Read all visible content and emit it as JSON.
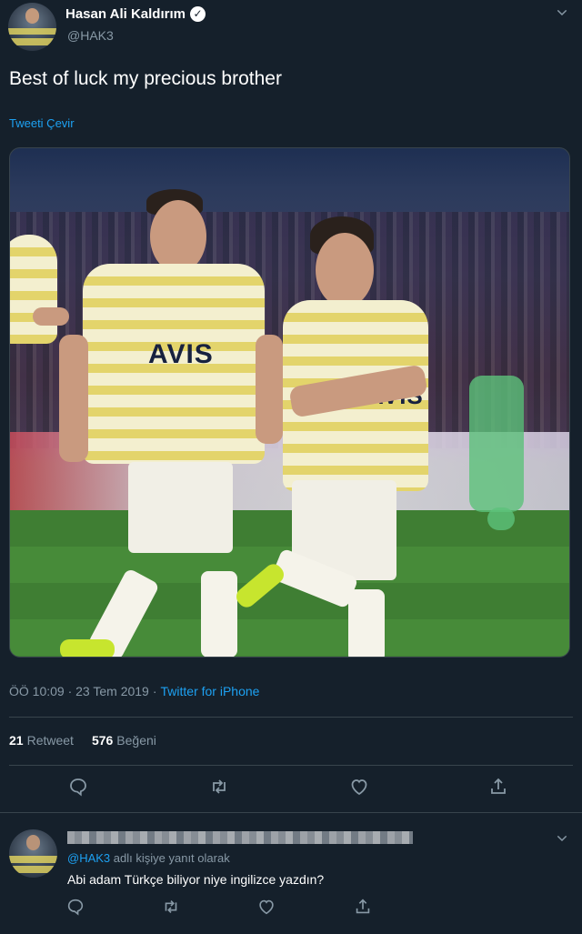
{
  "tweet": {
    "display_name": "Hasan Ali Kaldırım",
    "handle": "@HAK3",
    "verified": true,
    "text": "Best of luck my precious brother",
    "translate_label": "Tweeti Çevir",
    "timestamp": "ÖÖ 10:09 · 23 Tem 2019",
    "source_sep": "·",
    "source": "Twitter for iPhone",
    "retweet_count": "21",
    "retweet_label": "Retweet",
    "like_count": "576",
    "like_label": "Beğeni",
    "photo_jersey_text": "AVIS"
  },
  "reply": {
    "replying_to_handle": "@HAK3",
    "replying_to_suffix": "adlı kişiye yanıt olarak",
    "text": "Abi adam Türkçe biliyor niye ingilizce yazdın?"
  },
  "icons": {
    "reply": "reply-icon",
    "retweet": "retweet-icon",
    "like": "heart-icon",
    "share": "share-icon",
    "menu": "chevron-down-icon",
    "verified": "verified-icon"
  },
  "colors": {
    "background": "#15202b",
    "accent": "#1da1f2",
    "muted": "#8899a6",
    "border": "#38444d"
  }
}
